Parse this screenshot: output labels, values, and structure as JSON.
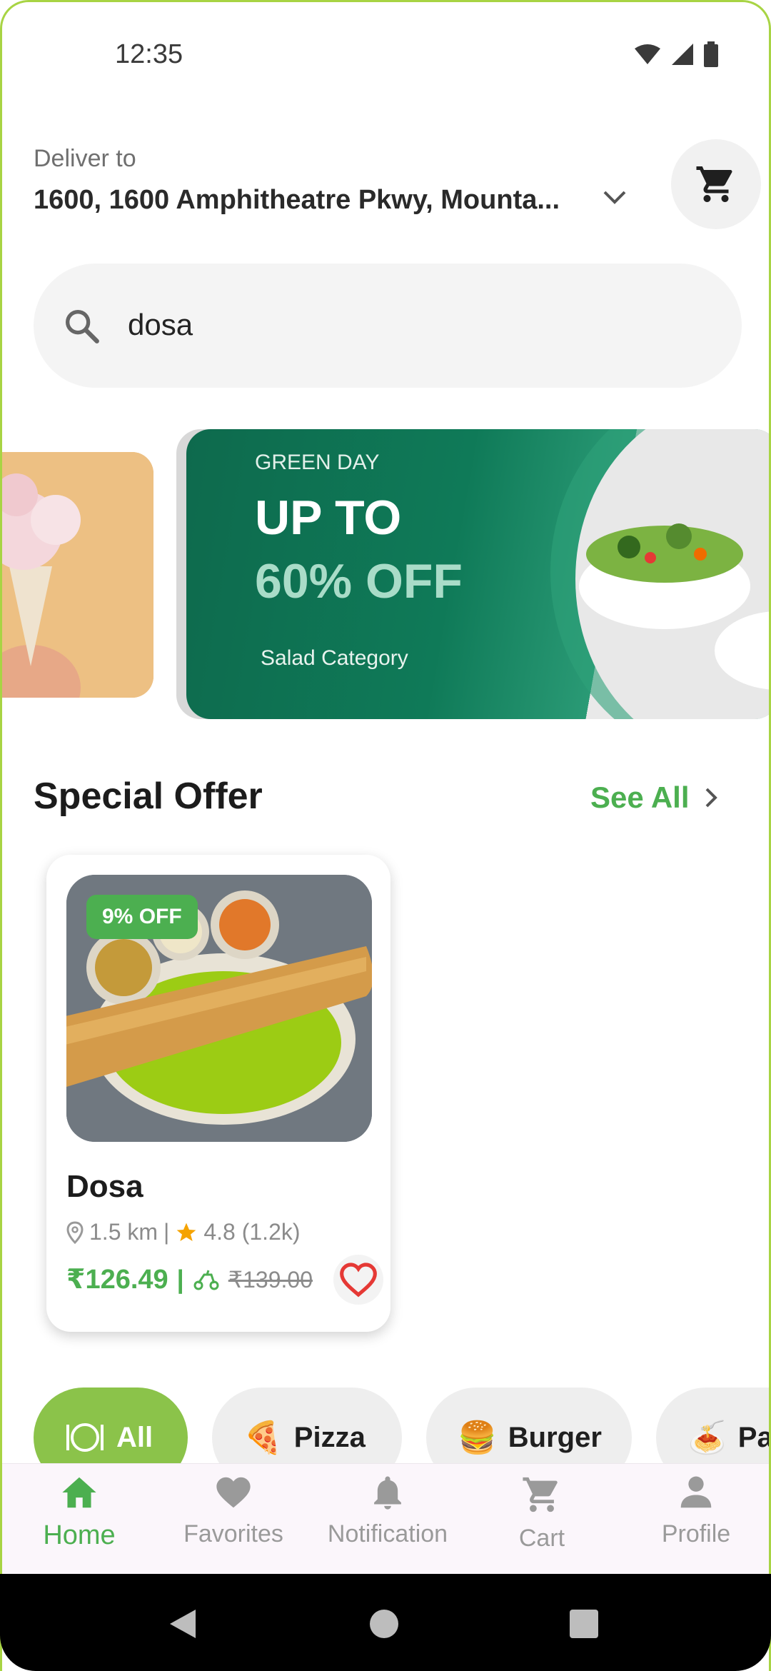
{
  "status_bar": {
    "time": "12:35"
  },
  "header": {
    "deliver_label": "Deliver to",
    "address": "1600, 1600 Amphitheatre Pkwy, Mounta..."
  },
  "search": {
    "value": "dosa"
  },
  "banner": {
    "tag": "GREEN DAY",
    "line1": "UP TO",
    "line2": "60% OFF",
    "subtitle": "Salad Category"
  },
  "special_offer": {
    "title": "Special Offer",
    "see_all": "See All",
    "item": {
      "badge": "9% OFF",
      "name": "Dosa",
      "distance": "1.5 km",
      "separator": "|",
      "rating": "4.8 (1.2k)",
      "price": "₹126.49",
      "price_separator": "|",
      "old_price": "₹139.00"
    }
  },
  "categories": [
    {
      "label": "All",
      "icon": "plate-icon",
      "active": true
    },
    {
      "label": "Pizza",
      "icon": "pizza-icon",
      "active": false
    },
    {
      "label": "Burger",
      "icon": "burger-icon",
      "active": false
    },
    {
      "label": "Pa",
      "icon": "pasta-icon",
      "active": false
    }
  ],
  "bottom_nav": [
    {
      "label": "Home",
      "icon": "home-icon",
      "active": true
    },
    {
      "label": "Favorites",
      "icon": "heart-icon",
      "active": false
    },
    {
      "label": "Notification",
      "icon": "bell-icon",
      "active": false
    },
    {
      "label": "Cart",
      "icon": "cart-icon",
      "active": false
    },
    {
      "label": "Profile",
      "icon": "person-icon",
      "active": false
    }
  ],
  "colors": {
    "accent": "#4caf50",
    "chip_active": "#8bc34a",
    "banner_green": "#0f7a58"
  }
}
